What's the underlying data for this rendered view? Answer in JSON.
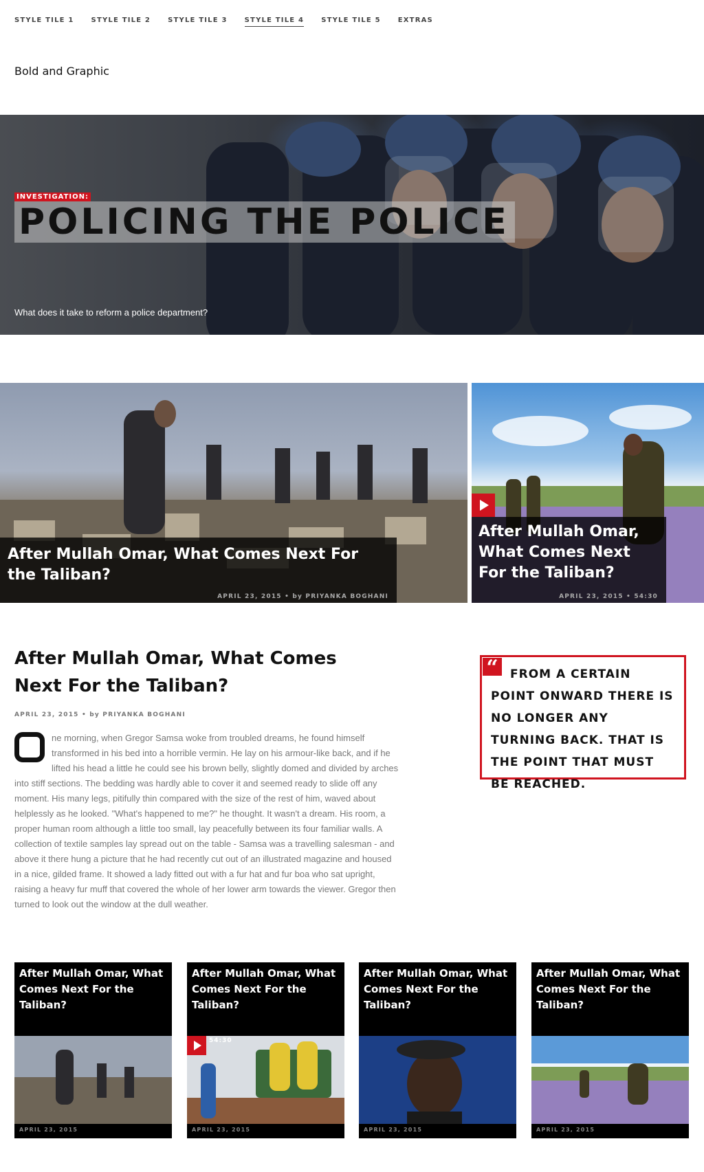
{
  "nav": {
    "items": [
      {
        "label": "STYLE TILE 1",
        "active": false
      },
      {
        "label": "STYLE TILE 2",
        "active": false
      },
      {
        "label": "STYLE TILE 3",
        "active": false
      },
      {
        "label": "STYLE TILE 4",
        "active": true
      },
      {
        "label": "STYLE TILE 5",
        "active": false
      },
      {
        "label": "EXTRAS",
        "active": false
      }
    ]
  },
  "tile_title": "Bold and Graphic",
  "hero": {
    "tag": "INVESTIGATION:",
    "title": "POLICING THE POLICE",
    "subtitle": "What does it take to reform a police department?"
  },
  "feature_big": {
    "title": "After Mullah Omar, What Comes Next For the Taliban?",
    "meta": "APRIL 23, 2015 • by PRIYANKA BOGHANI"
  },
  "feature_side": {
    "title": "After Mullah Omar, What Comes Next For the Taliban?",
    "meta": "APRIL 23, 2015 • 54:30",
    "play_icon": "play-icon"
  },
  "article": {
    "title": "After Mullah Omar, What Comes Next For the Taliban?",
    "meta": "APRIL 23, 2015 • by PRIYANKA BOGHANI",
    "dropcap": "O",
    "body": "ne morning, when Gregor Samsa woke from troubled dreams, he found himself transformed in his bed into a horrible vermin. He lay on his armour-like back, and if he lifted his head a little he could see his brown belly, slightly domed and divided by arches into stiff sections. The bedding was hardly able to cover it and seemed ready to slide off any moment. His many legs, pitifully thin compared with the size of the rest of him, waved about helplessly as he looked. \"What's happened to me?\" he thought. It wasn't a dream. His room, a proper human room although a little too small, lay peacefully between its four familiar walls. A collection of textile samples lay spread out on the table - Samsa was a travelling salesman - and above it there hung a picture that he had recently cut out of an illustrated magazine and housed in a nice, gilded frame. It showed a lady fitted out with a fur hat and fur boa who sat upright, raising a heavy fur muff that covered the whole of her lower arm towards the viewer. Gregor then turned to look out the window at the dull weather."
  },
  "pullquote": {
    "mark": "“",
    "text": "FROM A CERTAIN POINT ONWARD THERE IS NO LONGER ANY TURNING BACK. THAT IS THE POINT THAT MUST BE REACHED."
  },
  "cards": [
    {
      "title": "After Mullah Omar, What Comes Next For the Taliban?",
      "meta": "APRIL 23, 2015"
    },
    {
      "title": "After Mullah Omar, What Comes Next For the Taliban?",
      "meta": "APRIL 23, 2015",
      "duration": "54:30"
    },
    {
      "title": "After Mullah Omar, What Comes Next For the Taliban?",
      "meta": "APRIL 23, 2015"
    },
    {
      "title": "After Mullah Omar, What Comes Next For the Taliban?",
      "meta": "APRIL 23, 2015"
    }
  ],
  "colors": {
    "accent": "#d0141f",
    "text": "#111111",
    "muted": "#777777"
  }
}
